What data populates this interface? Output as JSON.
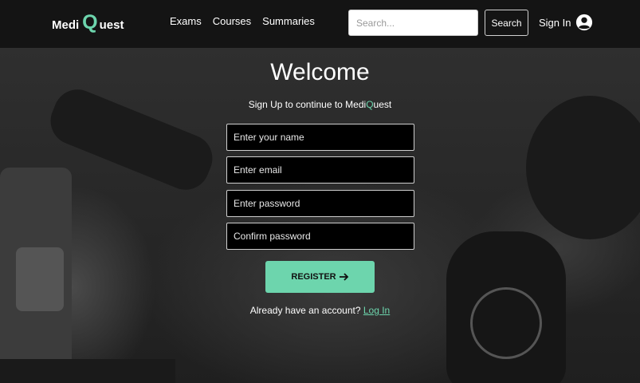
{
  "brand": {
    "part1": "Medi",
    "q": "Q",
    "part2": "uest",
    "accent": "#6dd5ad"
  },
  "nav": {
    "links": [
      "Exams",
      "Courses",
      "Summaries"
    ]
  },
  "search": {
    "placeholder": "Search...",
    "button_label": "Search"
  },
  "auth": {
    "signin_label": "Sign In",
    "signin_icon": "user-circle-icon"
  },
  "form": {
    "title": "Welcome",
    "subtitle_prefix": "Sign Up to continue to Medi",
    "subtitle_q": "Q",
    "subtitle_suffix": "uest",
    "fields": [
      {
        "placeholder": "Enter your name",
        "value": ""
      },
      {
        "placeholder": "Enter email",
        "value": ""
      },
      {
        "placeholder": "Enter password",
        "value": ""
      },
      {
        "placeholder": "Confirm password",
        "value": ""
      }
    ],
    "register_label": "REGISTER",
    "register_icon": "arrow-right-icon",
    "login_prompt": "Already have an account?",
    "login_link": "Log In"
  }
}
